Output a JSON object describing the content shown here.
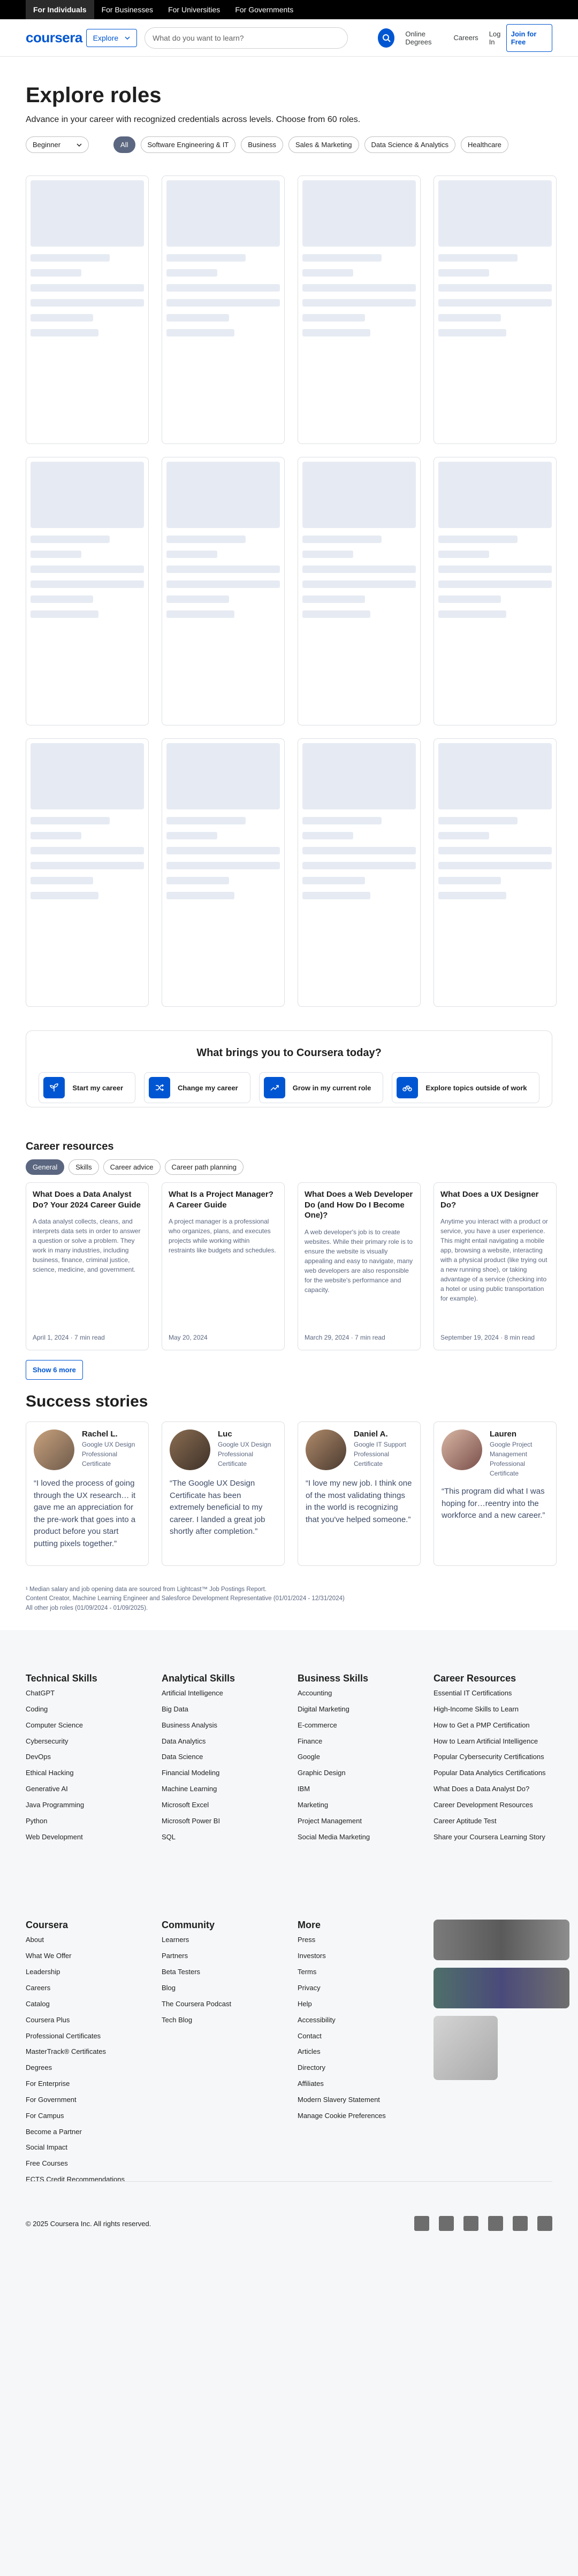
{
  "topbar": {
    "audiences": [
      "For Individuals",
      "For Businesses",
      "For Universities",
      "For Governments"
    ],
    "active_index": 0
  },
  "header": {
    "logo": "coursera",
    "explore_label": "Explore",
    "search_placeholder": "What do you want to learn?",
    "links": [
      "Online Degrees",
      "Careers",
      "Log In"
    ],
    "join_label": "Join for Free"
  },
  "hero": {
    "title": "Explore roles",
    "subtitle": "Advance in your career with recognized credentials across levels. Choose from 60 roles.",
    "level_select": "Beginner",
    "chips": [
      "All",
      "Software Engineering & IT",
      "Business",
      "Sales & Marketing",
      "Data Science & Analytics",
      "Healthcare"
    ],
    "active_chip": 0
  },
  "goal": {
    "title": "What brings you to Coursera today?",
    "options": [
      {
        "label": "Start my career",
        "icon": "seedling-icon"
      },
      {
        "label": "Change my career",
        "icon": "shuffle-icon"
      },
      {
        "label": "Grow in my current role",
        "icon": "trend-up-icon"
      },
      {
        "label": "Explore topics outside of work",
        "icon": "bike-icon"
      }
    ]
  },
  "career_resources": {
    "title": "Career resources",
    "tabs": [
      "General",
      "Skills",
      "Career advice",
      "Career path planning"
    ],
    "articles": [
      {
        "title": "What Does a Data Analyst Do? Your 2024 Career Guide",
        "summary": "A data analyst collects, cleans, and interprets data sets in order to answer a question or solve a problem. They work in many industries, including business, finance, criminal justice, science, medicine, and government.",
        "meta": "April 1, 2024 · 7 min read"
      },
      {
        "title": "What Is a Project Manager? A Career Guide",
        "summary": "A project manager is a professional who organizes, plans, and executes projects while working within restraints like budgets and schedules.",
        "meta": "May 20, 2024"
      },
      {
        "title": "What Does a Web Developer Do (and How Do I Become One)?",
        "summary": "A web developer's job is to create websites. While their primary role is to ensure the website is visually appealing and easy to navigate, many web developers are also responsible for the website's performance and capacity.",
        "meta": "March 29, 2024 · 7 min read"
      },
      {
        "title": "What Does a UX Designer Do?",
        "summary": "Anytime you interact with a product or service, you have a user experience. This might entail navigating a mobile app, browsing a website, interacting with a physical product (like trying out a new running shoe), or taking advantage of a service (checking into a hotel or using public transportation for example).",
        "meta": "September 19, 2024 · 8 min read"
      }
    ],
    "show_more": "Show 6 more"
  },
  "success": {
    "title": "Success stories",
    "stories": [
      {
        "name": "Rachel L.",
        "cert": "Google UX Design Professional Certificate",
        "quote": "“I loved the process of going through the UX research… it gave me an appreciation for the pre-work that goes into a product before you start putting pixels together.”"
      },
      {
        "name": "Luc",
        "cert": "Google UX Design Professional Certificate",
        "quote": "“The Google UX Design Certificate has been extremely beneficial to my career. I landed a great job shortly after completion.”"
      },
      {
        "name": "Daniel A.",
        "cert": "Google IT Support Professional Certificate",
        "quote": "“I love my new job. I think one of the most validating things in the world is recognizing that you've helped someone.”"
      },
      {
        "name": "Lauren",
        "cert": "Google Project Management Professional Certificate",
        "quote": "“This program did what I was hoping for…reentry into the workforce and a new career.”"
      }
    ]
  },
  "footnote": {
    "line1": "¹ Median salary and job opening data are sourced from Lightcast™ Job Postings Report.",
    "line2": "Content Creator, Machine Learning Engineer and Salesforce Development Representative (01/01/2024 - 12/31/2024)",
    "line3": "All other job roles (01/09/2024 - 01/09/2025)."
  },
  "footer": {
    "columns_top": [
      {
        "heading": "Technical Skills",
        "links": [
          "ChatGPT",
          "Coding",
          "Computer Science",
          "Cybersecurity",
          "DevOps",
          "Ethical Hacking",
          "Generative AI",
          "Java Programming",
          "Python",
          "Web Development"
        ]
      },
      {
        "heading": "Analytical Skills",
        "links": [
          "Artificial Intelligence",
          "Big Data",
          "Business Analysis",
          "Data Analytics",
          "Data Science",
          "Financial Modeling",
          "Machine Learning",
          "Microsoft Excel",
          "Microsoft Power BI",
          "SQL"
        ]
      },
      {
        "heading": "Business Skills",
        "links": [
          "Accounting",
          "Digital Marketing",
          "E-commerce",
          "Finance",
          "Google",
          "Graphic Design",
          "IBM",
          "Marketing",
          "Project Management",
          "Social Media Marketing"
        ]
      },
      {
        "heading": "Career Resources",
        "links": [
          "Essential IT Certifications",
          "High-Income Skills to Learn",
          "How to Get a PMP Certification",
          "How to Learn Artificial Intelligence",
          "Popular Cybersecurity Certifications",
          "Popular Data Analytics Certifications",
          "What Does a Data Analyst Do?",
          "Career Development Resources",
          "Career Aptitude Test",
          "Share your Coursera Learning Story"
        ]
      }
    ],
    "columns_bottom": [
      {
        "heading": "Coursera",
        "links": [
          "About",
          "What We Offer",
          "Leadership",
          "Careers",
          "Catalog",
          "Coursera Plus",
          "Professional Certificates",
          "MasterTrack® Certificates",
          "Degrees",
          "For Enterprise",
          "For Government",
          "For Campus",
          "Become a Partner",
          "Social Impact",
          "Free Courses",
          "ECTS Credit Recommendations"
        ]
      },
      {
        "heading": "Community",
        "links": [
          "Learners",
          "Partners",
          "Beta Testers",
          "Blog",
          "The Coursera Podcast",
          "Tech Blog"
        ]
      },
      {
        "heading": "More",
        "links": [
          "Press",
          "Investors",
          "Terms",
          "Privacy",
          "Help",
          "Accessibility",
          "Contact",
          "Articles",
          "Directory",
          "Affiliates",
          "Modern Slavery Statement",
          "Manage Cookie Preferences"
        ]
      }
    ],
    "copyright": "© 2025 Coursera Inc. All rights reserved."
  }
}
